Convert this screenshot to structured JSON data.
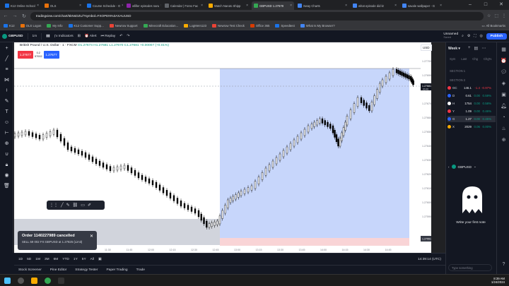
{
  "browser": {
    "tabs": [
      {
        "label": "K12 Online School",
        "color": "#1a73e8"
      },
      {
        "label": "OLS",
        "color": "#e8710a"
      },
      {
        "label": "Course Schedule - O",
        "color": "#1a73e8"
      },
      {
        "label": "wfiller episodes naru",
        "color": "#8e24aa"
      },
      {
        "label": "Calendar | Forex Fac",
        "color": "#5f6368"
      },
      {
        "label": "Watch Naruto Shipp",
        "color": "#f9ab00"
      },
      {
        "label": "GBPUSD 1.27678",
        "color": "#34a853"
      },
      {
        "label": "Sway Charts",
        "color": "#4285f4"
      },
      {
        "label": "what episode did kr",
        "color": "#4285f4"
      },
      {
        "label": "savale wallpaper - G",
        "color": "#4285f4"
      }
    ],
    "url": "tradingview.com/chart/5kNsDZU/?symbol=FXOPEN%3AXAUUSD",
    "bookmarks": [
      "K12",
      "OLS Logon",
      "My Info",
      "K12 Customer Supp...",
      "Newrow Support",
      "Minecraft Education...",
      "LogMeIn123",
      "Newrow Test Check",
      "Office 365",
      "Speedtest",
      "What Is My Browser?"
    ],
    "all_bookmarks": "All Bookmarks"
  },
  "tv_header": {
    "symbol": "GBPUSD",
    "interval": "1m",
    "indicators": "Indicators",
    "alert": "Alert",
    "replay": "Replay",
    "layout_name": "Unnamed",
    "layout_status": "Saved",
    "publish": "Publish"
  },
  "chart_header": {
    "title": "British Pound / U.S. Dollar · 1 · FXCM",
    "ohlc": "O1.27674 H1.27681 L1.27670 C1.27681 +0.00007 (+0.01%)",
    "sell_price": "1.27677",
    "buy_price": "1.27677",
    "spread_top": "0.2",
    "spread_bottom": "57002",
    "currency": "USD"
  },
  "toast": {
    "title": "Order 1140227989 cancelled",
    "detail": "SELL 59 002 FX:GBPUSD at 1.27825 (Limit)"
  },
  "bottom_bar": {
    "ranges": [
      "1D",
      "5D",
      "1M",
      "3M",
      "6M",
      "YTD",
      "1Y",
      "5Y",
      "All"
    ],
    "timezone": "14:39:14 (UTC)",
    "tabs": [
      "Stock Screener",
      "Pine Editor",
      "Strategy Tester",
      "Paper Trading",
      "Trade"
    ]
  },
  "watchlist": {
    "title": "Week",
    "columns": [
      "Sym",
      "Last",
      "Chg",
      "Chg%"
    ],
    "section1": "SECTION 1",
    "section2": "SECTION 2",
    "rows": [
      {
        "sym": "GC",
        "last": "146.1",
        "chg": "-1.4",
        "pct": "-0.97%",
        "dir": "dn",
        "color": "#f23645"
      },
      {
        "sym": "D",
        "last": "0.61",
        "chg": "0.00",
        "pct": "0.59%",
        "dir": "up",
        "color": "#2962ff"
      },
      {
        "sym": "H",
        "last": "1754",
        "chg": "0.00",
        "pct": "0.58%",
        "dir": "up",
        "color": "#fff"
      },
      {
        "sym": "Y",
        "last": "1.09",
        "chg": "0.00",
        "pct": "0.46%",
        "dir": "up",
        "color": "#f23645"
      },
      {
        "sym": "G",
        "last": "1.27",
        "chg": "0.00",
        "pct": "0.45%",
        "dir": "up",
        "color": "#2962ff"
      },
      {
        "sym": "X",
        "last": "2029",
        "chg": "0.06",
        "pct": "0.00%",
        "dir": "up",
        "color": "#f9ab00"
      }
    ],
    "detail_symbol": "GBPUSD",
    "empty_text": "Write your first note",
    "search_placeholder": "Type something"
  },
  "price_axis": {
    "labels": [
      "1.27700",
      "1.27690",
      "1.27680",
      "1.27670",
      "1.27660",
      "1.27650",
      "1.27640",
      "1.27630",
      "1.27620",
      "1.27610",
      "1.27600",
      "1.27590"
    ],
    "current_price": "1.27681",
    "countdown": "00:46",
    "low_tag": "1.27551"
  },
  "time_axis": {
    "labels": [
      "11:30",
      "11:45",
      "12:00",
      "12:15",
      "12:30",
      "12:45",
      "13:00",
      "13:15",
      "13:30",
      "13:45",
      "14:00",
      "14:15",
      "14:30",
      "14:45"
    ]
  },
  "taskbar": {
    "time": "8:39 AM",
    "date": "1/24/2024"
  },
  "colors": {
    "up": "#089981",
    "down": "#f23645",
    "accent": "#2962ff"
  }
}
